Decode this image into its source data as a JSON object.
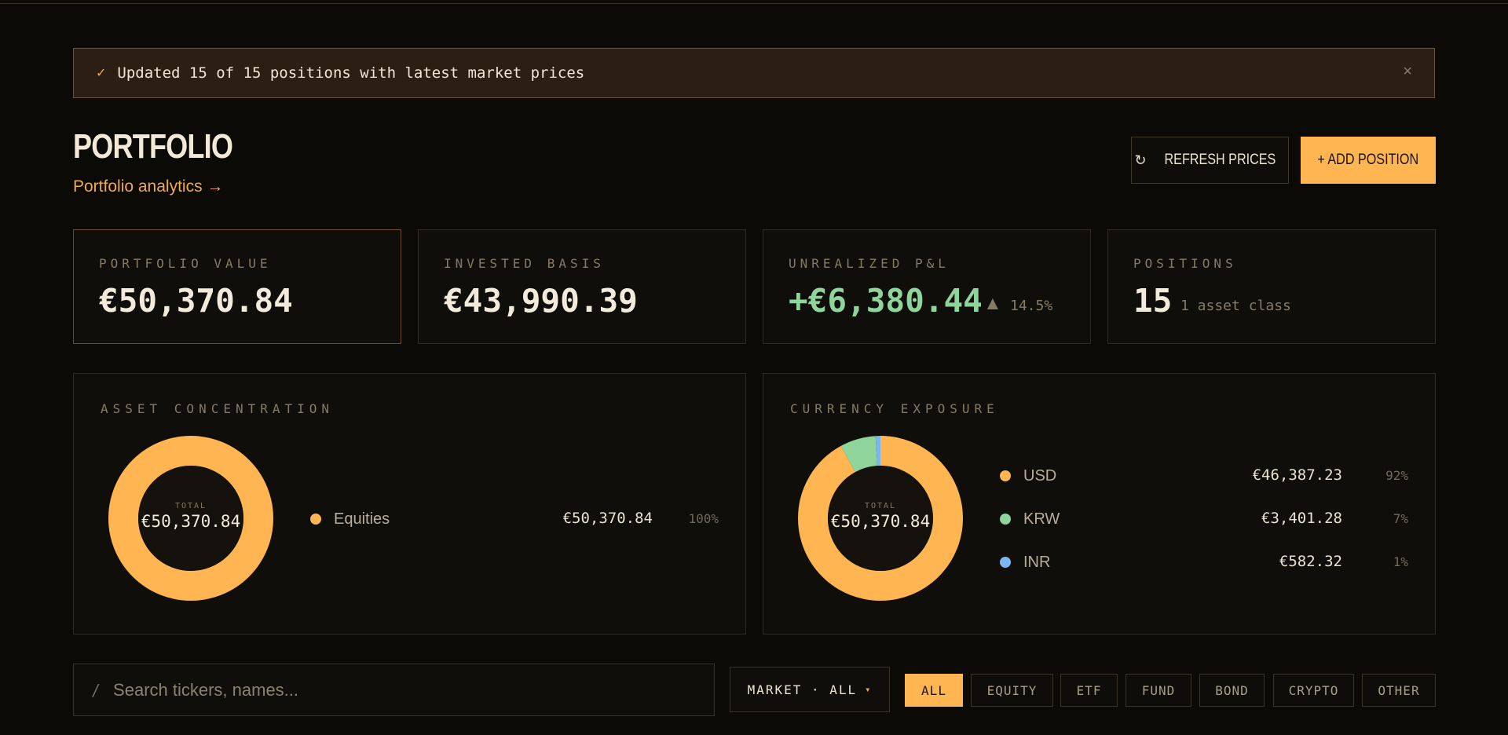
{
  "notice": {
    "icon": "check-icon",
    "message": "Updated 15 of 15 positions with latest market prices",
    "close": "×"
  },
  "header": {
    "title": "PORTFOLIO",
    "analytics_link": "Portfolio analytics →"
  },
  "actions": {
    "refresh_icon": "↻",
    "refresh_label": "REFRESH PRICES",
    "add_label": "+ ADD POSITION"
  },
  "stats": {
    "portfolio_value": {
      "label": "PORTFOLIO VALUE",
      "value": "€50,370.84"
    },
    "invested_basis": {
      "label": "INVESTED BASIS",
      "value": "€43,990.39"
    },
    "unrealized": {
      "label": "UNREALIZED P&L",
      "value": "+€6,380.44",
      "arrow": "▲",
      "pct": "14.5%"
    },
    "positions": {
      "label": "POSITIONS",
      "value": "15",
      "sub": "1 asset class"
    }
  },
  "asset_concentration": {
    "title": "ASSET CONCENTRATION",
    "total_label": "TOTAL",
    "total_value": "€50,370.84",
    "items": [
      {
        "name": "Equities",
        "amount": "€50,370.84",
        "pct": "100%",
        "color": "#ffb552"
      }
    ]
  },
  "currency_exposure": {
    "title": "CURRENCY EXPOSURE",
    "total_label": "TOTAL",
    "total_value": "€50,370.84",
    "items": [
      {
        "name": "USD",
        "amount": "€46,387.23",
        "pct": "92%",
        "color": "#ffb552"
      },
      {
        "name": "KRW",
        "amount": "€3,401.28",
        "pct": "7%",
        "color": "#8fd49a"
      },
      {
        "name": "INR",
        "amount": "€582.32",
        "pct": "1%",
        "color": "#7cb6f0"
      }
    ]
  },
  "filters": {
    "search_slash": "/",
    "search_placeholder": "Search tickers, names...",
    "market_label": "MARKET · ALL",
    "market_caret": "▾",
    "chips": [
      "ALL",
      "EQUITY",
      "ETF",
      "FUND",
      "BOND",
      "CRYPTO",
      "OTHER"
    ],
    "active_chip": "ALL"
  }
}
